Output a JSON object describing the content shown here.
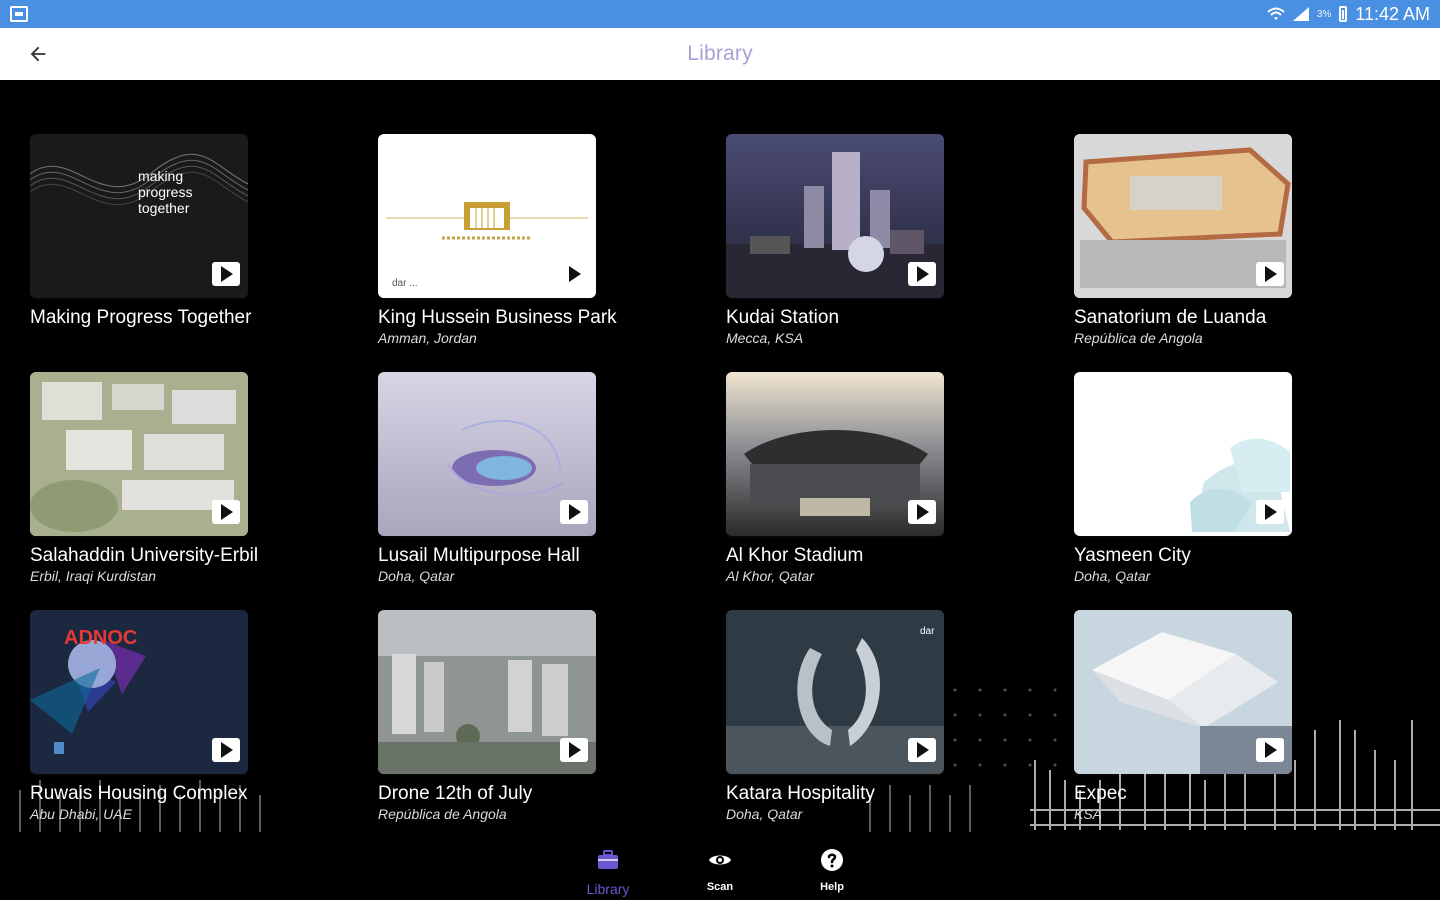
{
  "status_bar": {
    "time": "11:42 AM",
    "battery_percent": "3%"
  },
  "app_bar": {
    "title": "Library"
  },
  "library": {
    "items": [
      {
        "title": "Making Progress Together",
        "subtitle": "",
        "thumb_text": "making progress together"
      },
      {
        "title": "King Hussein Business Park",
        "subtitle": "Amman, Jordan",
        "thumb_text": "dar ..."
      },
      {
        "title": "Kudai Station",
        "subtitle": "Mecca, KSA"
      },
      {
        "title": "Sanatorium de Luanda",
        "subtitle": "República de Angola"
      },
      {
        "title": "Salahaddin University-Erbil",
        "subtitle": "Erbil, Iraqi Kurdistan"
      },
      {
        "title": "Lusail Multipurpose Hall",
        "subtitle": "Doha, Qatar"
      },
      {
        "title": "Al Khor Stadium",
        "subtitle": "Al Khor, Qatar"
      },
      {
        "title": "Yasmeen City",
        "subtitle": "Doha, Qatar"
      },
      {
        "title": "Ruwais Housing Complex",
        "subtitle": "Abu Dhabi, UAE",
        "thumb_text": "ADNOC"
      },
      {
        "title": "Drone 12th of July",
        "subtitle": "República de Angola"
      },
      {
        "title": "Katara Hospitality",
        "subtitle": "Doha, Qatar",
        "thumb_text": "dar"
      },
      {
        "title": "Expec",
        "subtitle": "KSA"
      }
    ]
  },
  "bottom_nav": {
    "items": [
      {
        "label": "Library",
        "active": true
      },
      {
        "label": "Scan",
        "active": false
      },
      {
        "label": "Help",
        "active": false
      }
    ]
  },
  "colors": {
    "status_bar": "#4a90e2",
    "title": "#a8a1d9",
    "active_nav": "#6e56cf"
  },
  "icons": {
    "back": "arrow-left-icon",
    "library": "briefcase-icon",
    "scan": "eye-icon",
    "help": "question-icon",
    "play": "play-icon"
  }
}
